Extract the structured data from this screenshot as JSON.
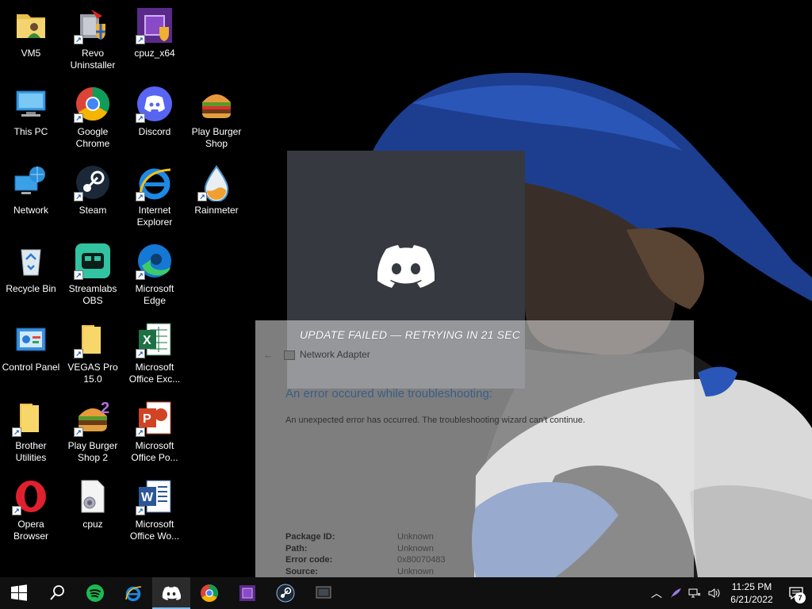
{
  "desktop": {
    "icons": [
      {
        "label": "VM5",
        "icon": "folder-user-icon"
      },
      {
        "label": "Revo\nUninstaller",
        "icon": "revo-uninstaller-icon"
      },
      {
        "label": "cpuz_x64",
        "icon": "cpuz-icon"
      },
      {
        "label": "This PC",
        "icon": "this-pc-icon"
      },
      {
        "label": "Google\nChrome",
        "icon": "chrome-icon"
      },
      {
        "label": "Discord",
        "icon": "discord-icon"
      },
      {
        "label": "Play Burger\nShop",
        "icon": "burger-icon"
      },
      {
        "label": "Network",
        "icon": "network-icon"
      },
      {
        "label": "Steam",
        "icon": "steam-icon"
      },
      {
        "label": "Internet\nExplorer",
        "icon": "internet-explorer-icon"
      },
      {
        "label": "Rainmeter",
        "icon": "rainmeter-icon"
      },
      {
        "label": "Recycle Bin",
        "icon": "recycle-bin-icon"
      },
      {
        "label": "Streamlabs\nOBS",
        "icon": "streamlabs-icon"
      },
      {
        "label": "Microsoft\nEdge",
        "icon": "edge-icon"
      },
      {
        "label": "Control Panel",
        "icon": "control-panel-icon"
      },
      {
        "label": "VEGAS Pro\n15.0",
        "icon": "folder-icon"
      },
      {
        "label": "Microsoft\nOffice Exc...",
        "icon": "excel-icon"
      },
      {
        "label": "Brother\nUtilities",
        "icon": "folder-icon"
      },
      {
        "label": "Play Burger\nShop 2",
        "icon": "burger-2-icon"
      },
      {
        "label": "Microsoft\nOffice Po...",
        "icon": "powerpoint-icon"
      },
      {
        "label": "Opera\nBrowser",
        "icon": "opera-icon"
      },
      {
        "label": "cpuz",
        "icon": "cpuz-file-icon"
      },
      {
        "label": "Microsoft\nOffice Wo...",
        "icon": "word-icon"
      }
    ]
  },
  "discord_updater": {
    "status": "UPDATE FAILED — RETRYING IN 21 SEC"
  },
  "troubleshooter": {
    "window_title": "Network Adapter",
    "heading": "An error occured while troubleshooting:",
    "description": "An unexpected error has occurred. The troubleshooting wizard can't continue.",
    "details": [
      {
        "key": "Package ID:",
        "value": "Unknown"
      },
      {
        "key": "Path:",
        "value": "Unknown"
      },
      {
        "key": "Error code:",
        "value": "0x80070483"
      },
      {
        "key": "Source:",
        "value": "Unknown"
      }
    ]
  },
  "taskbar": {
    "pinned": [
      "start",
      "search",
      "spotify",
      "internet-explorer",
      "discord",
      "chrome",
      "cpuz",
      "steam",
      "vm"
    ],
    "active": "discord",
    "clock": {
      "time": "11:25 PM",
      "date": "6/21/2022"
    },
    "notification_count": "7"
  },
  "colors": {
    "discord_bg": "#36393f",
    "taskbar_bg": "#101010",
    "accent": "#76b9ed",
    "heading_blue": "#3b5d8a"
  }
}
